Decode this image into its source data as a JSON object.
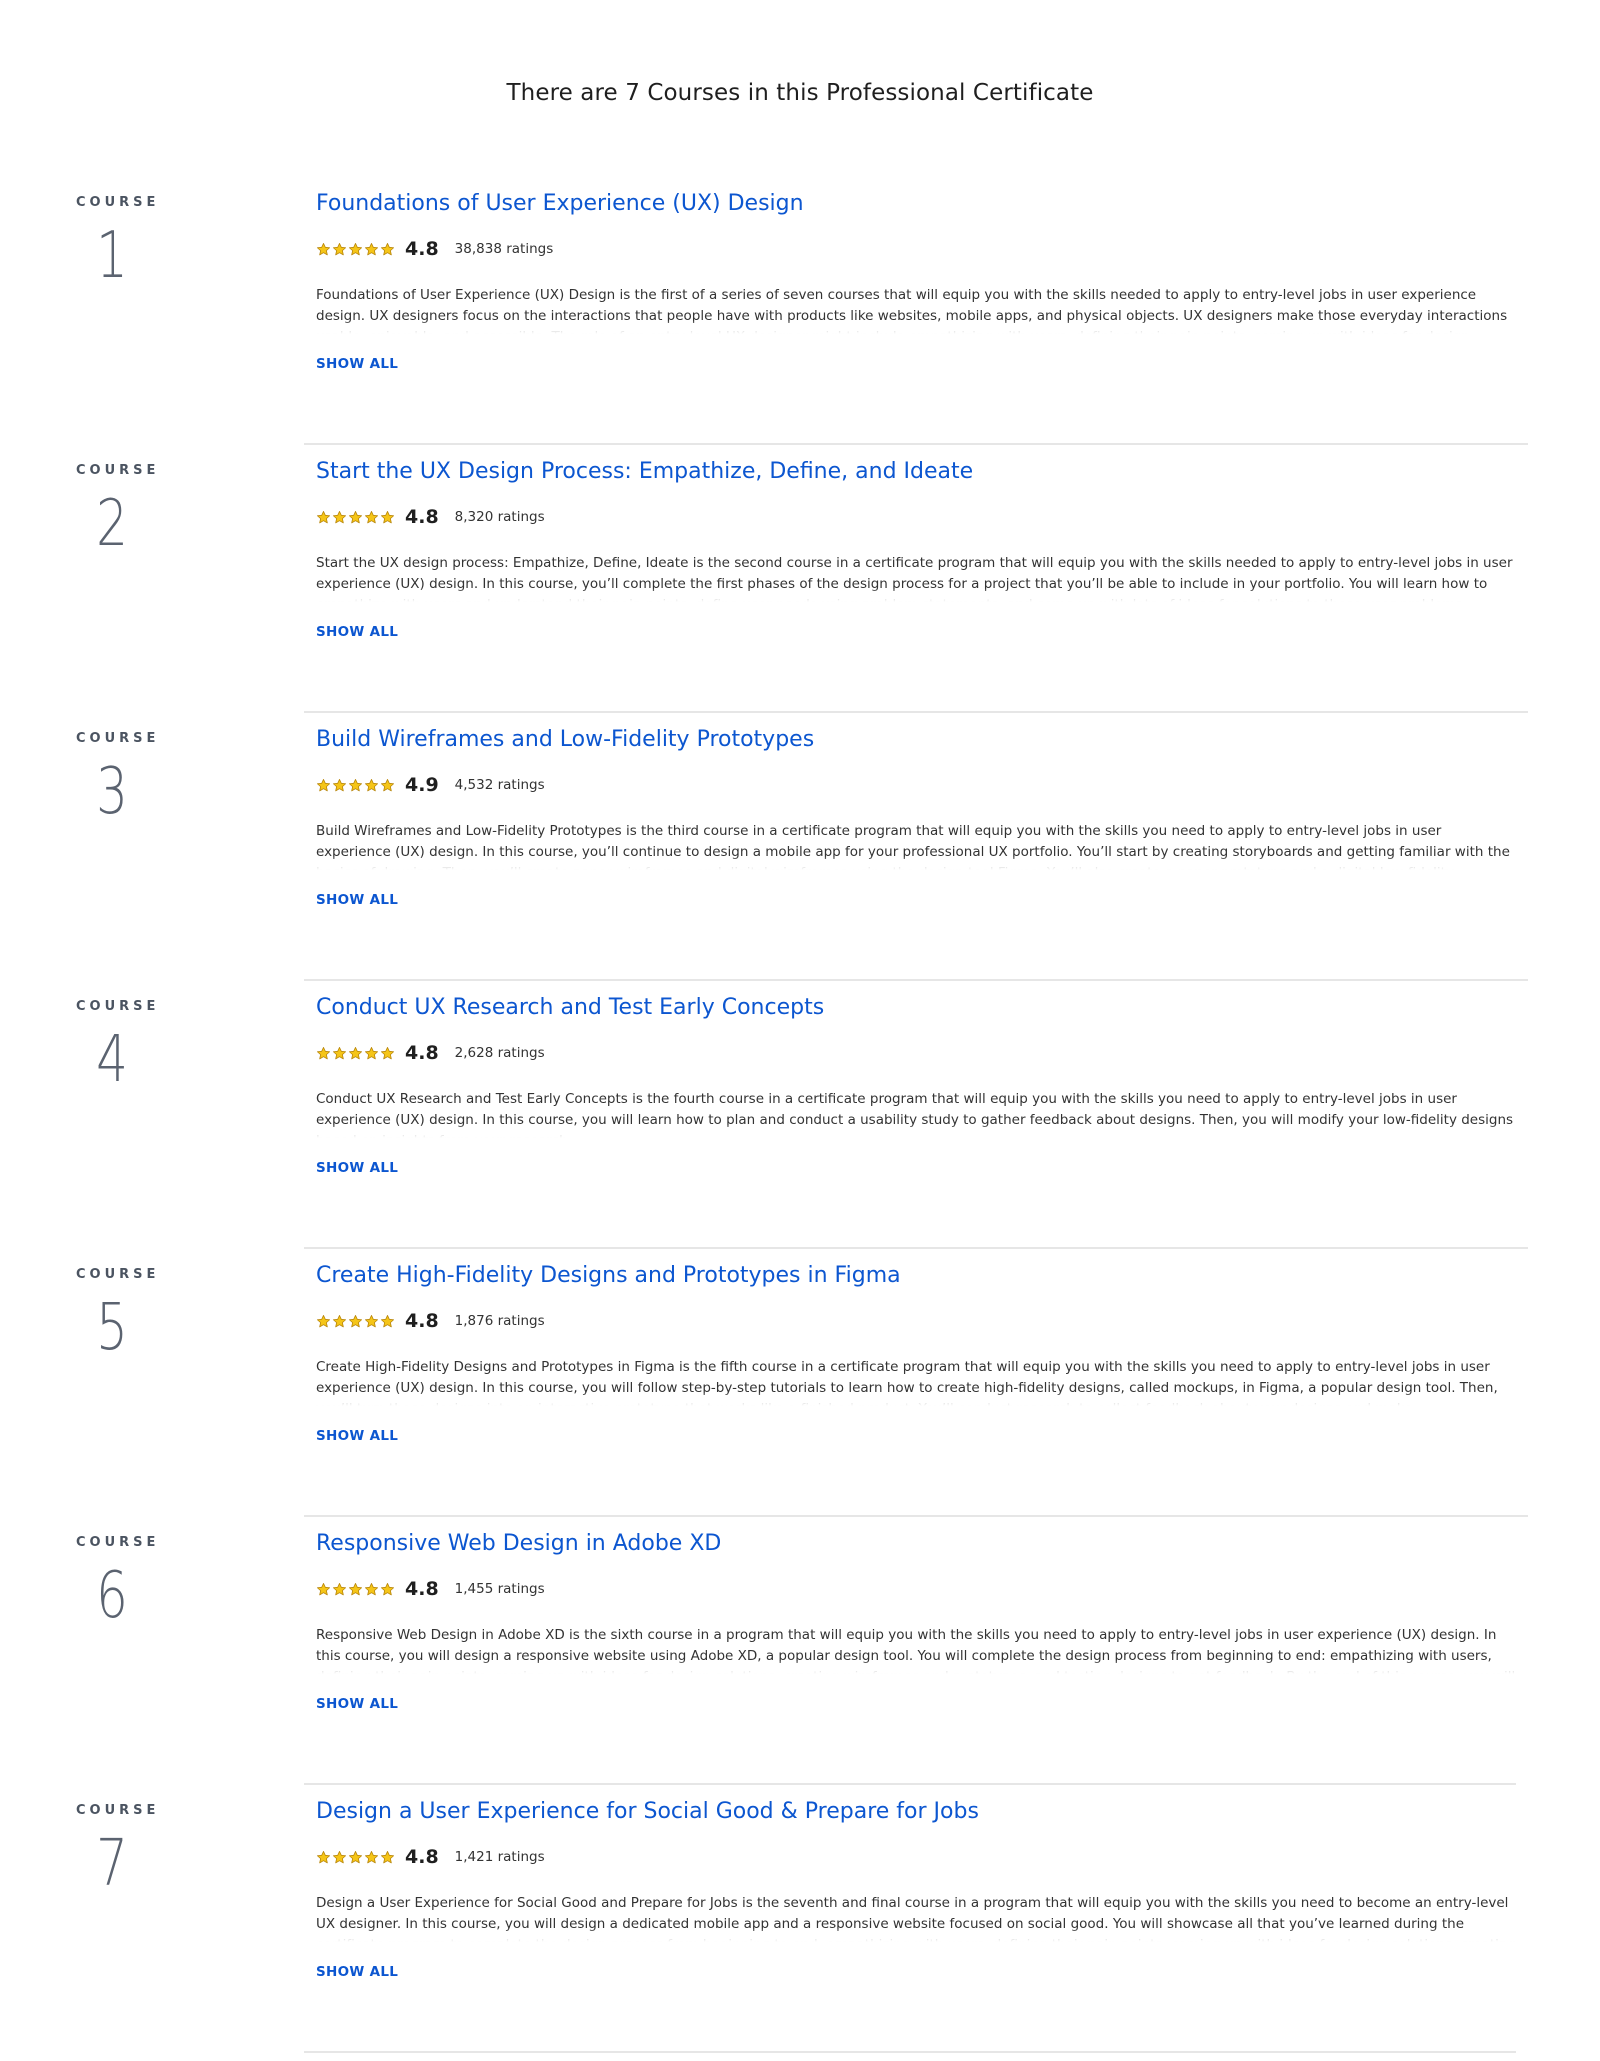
{
  "page": {
    "heading": "There are 7 Courses in this Professional Certificate"
  },
  "colors": {
    "link": "#0c56d0",
    "star": "#f5c518",
    "divider": "#e6e6e6"
  },
  "courses": [
    {
      "label": "COURSE",
      "number": "1",
      "title": "Foundations of User Experience (UX) Design",
      "rating": "4.8",
      "stars": 5,
      "ratings_count": "38,838 ratings",
      "description": "Foundations of User Experience (UX) Design is the first of a series of seven courses that will equip you with the skills needed to apply to entry-level jobs in user experience design. UX designers focus on the interactions that people have with products like websites, mobile apps, and physical objects. UX designers make those everyday interactions usable, enjoyable, and accessible. The role of an entry-level UX designer might include empathizing with users, defining their pain points, coming up with ideas for design solutions, creating",
      "show_all": "SHOW ALL"
    },
    {
      "label": "COURSE",
      "number": "2",
      "title": "Start the UX Design Process: Empathize, Define, and Ideate",
      "rating": "4.8",
      "stars": 5,
      "ratings_count": "8,320 ratings",
      "description": "Start the UX design process: Empathize, Define, Ideate is the second course in a certificate program that will equip you with the skills needed to apply to entry-level jobs in user experience (UX) design. In this course, you’ll complete the first phases of the design process for a project that you’ll be able to include in your portfolio. You will learn how to empathize with users and understand their pain points, define user needs using problem statements, and come up with lots of ideas for solutions to those user problems.",
      "show_all": "SHOW ALL"
    },
    {
      "label": "COURSE",
      "number": "3",
      "title": "Build Wireframes and Low-Fidelity Prototypes",
      "rating": "4.9",
      "stars": 5,
      "ratings_count": "4,532 ratings",
      "description": "Build Wireframes and Low-Fidelity Prototypes is the third course in a certificate program that will equip you with the skills you need to apply to entry-level jobs in user experience (UX) design. In this course, you’ll continue to design a mobile app for your professional UX portfolio. You’ll start by creating storyboards and getting familiar with the basics of drawing. Then, you’ll create paper wireframes and digital wireframes using the design tool Figma. You’ll also create a paper prototype and a digital low-fidelity prototype in Figma.",
      "show_all": "SHOW ALL"
    },
    {
      "label": "COURSE",
      "number": "4",
      "title": "Conduct UX Research and Test Early Concepts",
      "rating": "4.8",
      "stars": 5,
      "ratings_count": "2,628 ratings",
      "description": "Conduct UX Research and Test Early Concepts is the fourth course in a certificate program that will equip you with the skills you need to apply to entry-level jobs in user experience (UX) design. In this course, you will learn how to plan and conduct a usability study to gather feedback about designs. Then, you will modify your low-fidelity designs based on insights from your research.",
      "show_all": "SHOW ALL"
    },
    {
      "label": "COURSE",
      "number": "5",
      "title": "Create High-Fidelity Designs and Prototypes in Figma",
      "rating": "4.8",
      "stars": 5,
      "ratings_count": "1,876 ratings",
      "description": "Create High-Fidelity Designs and Prototypes in Figma is the fifth course in a certificate program that will equip you with the skills you need to apply to entry-level jobs in user experience (UX) design. In this course, you will follow step-by-step tutorials to learn how to create high-fidelity designs, called mockups, in Figma, a popular design tool. Then, you’ll turn those designs into an interactive prototype that works like a finished product. You’ll conduct research to collect feedback about your designs and make improvements. Finally,",
      "show_all": "SHOW ALL"
    },
    {
      "label": "COURSE",
      "number": "6",
      "title": "Responsive Web Design in Adobe XD",
      "rating": "4.8",
      "stars": 5,
      "ratings_count": "1,455 ratings",
      "description": "Responsive Web Design in Adobe XD is the sixth course in a program that will equip you with the skills you need to apply to entry-level jobs in user experience (UX) design. In this course, you will design a responsive website using Adobe XD, a popular design tool. You will complete the design process from beginning to end: empathizing with users, defining their pain points, coming up with ideas for design solutions, creating wireframes and prototypes, and testing designs to get feedback. By the end of this course, you will have a new",
      "show_all": "SHOW ALL"
    },
    {
      "label": "COURSE",
      "number": "7",
      "title": "Design a User Experience for Social Good & Prepare for Jobs",
      "rating": "4.8",
      "stars": 5,
      "ratings_count": "1,421 ratings",
      "description": "Design a User Experience for Social Good and Prepare for Jobs is the seventh and final course in a program that will equip you with the skills you need to become an entry-level UX designer. In this course, you will design a dedicated mobile app and a responsive website focused on social good. You will showcase all that you’ve learned during the certificate program to complete the design process from beginning to end: empathizing with users, defining their pain points, coming up with ideas for design solutions, creating wireframes",
      "show_all": "SHOW ALL"
    }
  ]
}
